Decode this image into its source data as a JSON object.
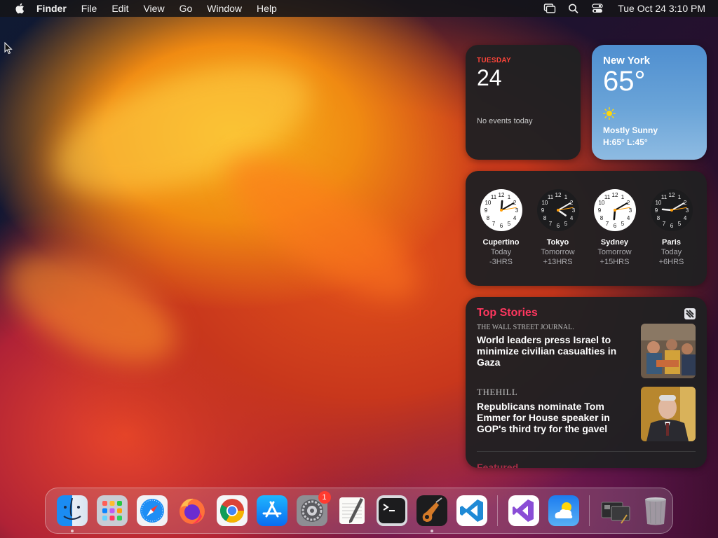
{
  "menubar": {
    "app_name": "Finder",
    "menus": [
      "File",
      "Edit",
      "View",
      "Go",
      "Window",
      "Help"
    ],
    "status_icons": [
      "screen-mirroring-icon",
      "search-icon",
      "control-center-icon"
    ],
    "clock": "Tue Oct 24  3:10 PM"
  },
  "widgets": {
    "calendar": {
      "dow": "TUESDAY",
      "day": "24",
      "events": "No events today"
    },
    "weather": {
      "city": "New York",
      "temp": "65°",
      "condition": "Mostly Sunny",
      "hilo": "H:65° L:45°"
    },
    "world_clock": [
      {
        "city": "Cupertino",
        "day": "Today",
        "offset": "-3HRS",
        "theme": "light",
        "hour": 12,
        "minute": 10
      },
      {
        "city": "Tokyo",
        "day": "Tomorrow",
        "offset": "+13HRS",
        "theme": "dark",
        "hour": 4,
        "minute": 10
      },
      {
        "city": "Sydney",
        "day": "Tomorrow",
        "offset": "+15HRS",
        "theme": "light",
        "hour": 6,
        "minute": 10
      },
      {
        "city": "Paris",
        "day": "Today",
        "offset": "+6HRS",
        "theme": "dark",
        "hour": 9,
        "minute": 10
      }
    ],
    "news": {
      "title": "Top Stories",
      "stories": [
        {
          "source": "THE WALL STREET JOURNAL.",
          "headline": "World leaders press Israel to minimize civilian casualties in Gaza"
        },
        {
          "source": "THEHILL",
          "headline": "Republicans nominate Tom Emmer for House speaker in GOP's third try for the gavel"
        }
      ],
      "featured": "Featured"
    }
  },
  "dock": {
    "apps": [
      {
        "name": "Finder",
        "icon": "finder-icon",
        "running": true
      },
      {
        "name": "Launchpad",
        "icon": "launchpad-icon",
        "running": false
      },
      {
        "name": "Safari",
        "icon": "safari-icon",
        "running": false
      },
      {
        "name": "Firefox",
        "icon": "firefox-icon",
        "running": false
      },
      {
        "name": "Google Chrome",
        "icon": "chrome-icon",
        "running": false
      },
      {
        "name": "App Store",
        "icon": "app-store-icon",
        "running": false
      },
      {
        "name": "System Settings",
        "icon": "system-settings-icon",
        "running": false,
        "badge": "1"
      },
      {
        "name": "TextEdit",
        "icon": "textedit-icon",
        "running": false
      },
      {
        "name": "Terminal",
        "icon": "terminal-icon",
        "running": false
      },
      {
        "name": "GarageBand",
        "icon": "garageband-icon",
        "running": true
      },
      {
        "name": "Visual Studio Code",
        "icon": "vscode-icon",
        "running": false
      },
      {
        "name": "Visual Studio",
        "icon": "visual-studio-icon",
        "running": false
      },
      {
        "name": "Weather",
        "icon": "weather-icon",
        "running": false
      },
      {
        "name": "Downloads Stack",
        "icon": "downloads-stack-icon",
        "running": false
      },
      {
        "name": "Trash",
        "icon": "trash-icon",
        "running": false
      }
    ]
  },
  "colors": {
    "calendar_accent": "#ff453a",
    "news_accent": "#ff375f",
    "badge": "#ff3b30"
  }
}
